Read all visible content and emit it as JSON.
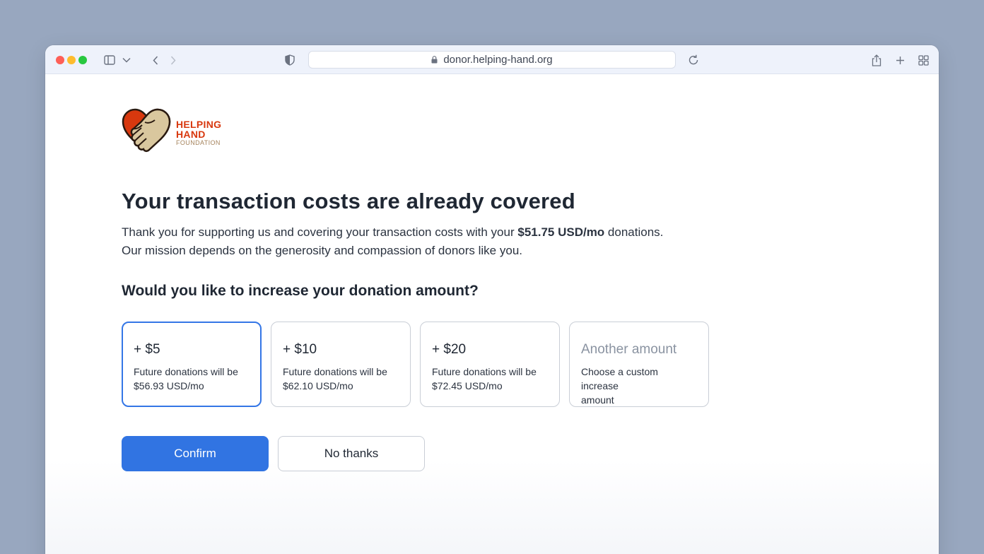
{
  "browser": {
    "url": "donor.helping-hand.org",
    "icons": [
      "sidebar-toggle-icon",
      "chevron-down-icon",
      "back-icon",
      "forward-icon",
      "shield-icon",
      "lock-icon",
      "reload-icon",
      "share-icon",
      "new-tab-icon",
      "tab-overview-icon"
    ]
  },
  "logo": {
    "line1": "HELPING",
    "line2": "HAND",
    "line3": "FOUNDATION",
    "colors": {
      "heart": "#d8380e",
      "hand": "#d9c79e"
    }
  },
  "page": {
    "headline": "Your transaction costs are already covered",
    "intro_part1": "Thank you for supporting us and covering your transaction costs with your ",
    "intro_amount": "$51.75 USD/mo",
    "intro_part2": " donations.",
    "intro_line2": "Our mission depends on the generosity and compassion of donors like you.",
    "question": "Would you like to increase your donation amount?"
  },
  "options": [
    {
      "title": "+ $5",
      "desc_line1": "Future donations will be",
      "desc_line2": "$56.93 USD/mo",
      "selected": true
    },
    {
      "title": "+ $10",
      "desc_line1": "Future donations will be",
      "desc_line2": "$62.10 USD/mo",
      "selected": false
    },
    {
      "title": "+ $20",
      "desc_line1": "Future donations will be",
      "desc_line2": "$72.45 USD/mo",
      "selected": false
    },
    {
      "title": "Another amount",
      "desc_line1": "Choose a custom increase",
      "desc_line2": "amount",
      "selected": false
    }
  ],
  "actions": {
    "confirm_label": "Confirm",
    "decline_label": "No thanks"
  },
  "colors": {
    "accent": "#3174e2",
    "selected_border": "#3476e6",
    "background": "#98a7bf"
  }
}
